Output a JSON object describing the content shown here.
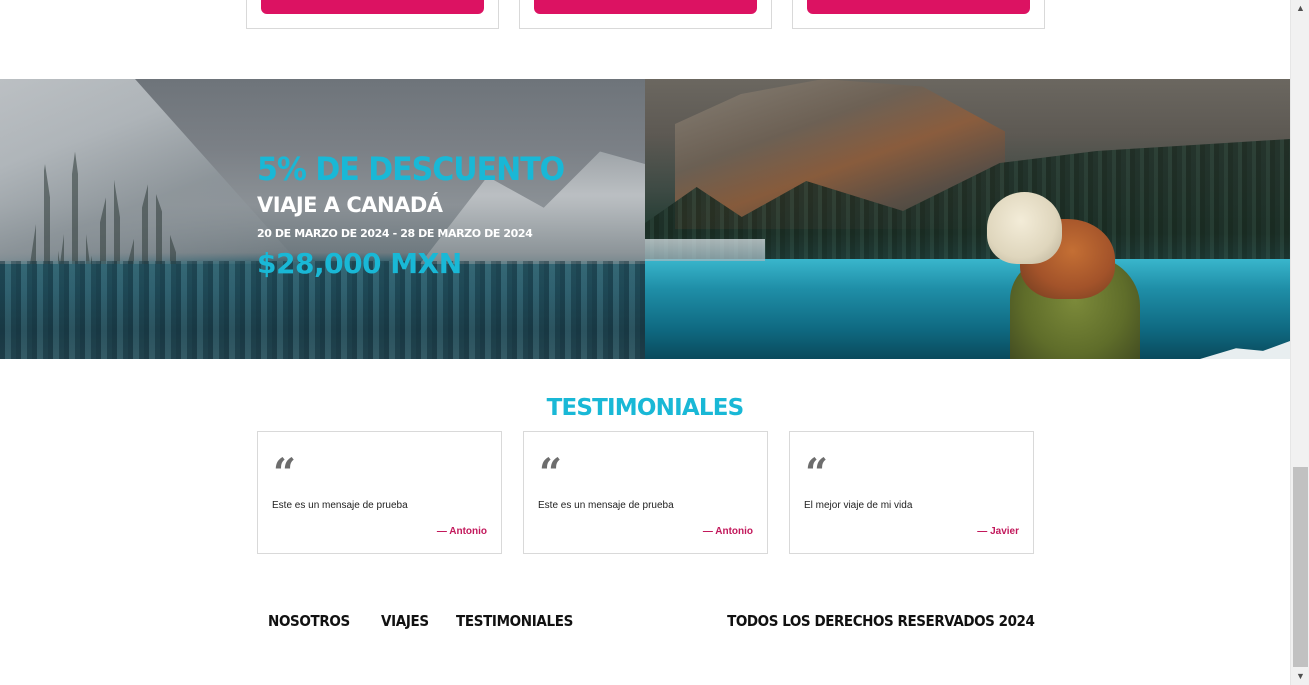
{
  "promo": {
    "discount": "5% DE DESCUENTO",
    "trip": "VIAJE A CANADÁ",
    "dates": "20 DE MARZO DE 2024 - 28 DE MARZO DE 2024",
    "price": "$28,000 MXN"
  },
  "testimonials": {
    "title": "TESTIMONIALES",
    "items": [
      {
        "message": "Este es un mensaje de prueba",
        "author": "— Antonio"
      },
      {
        "message": "Este es un mensaje de prueba",
        "author": "— Antonio"
      },
      {
        "message": "El mejor viaje de mi vida",
        "author": "— Javier"
      }
    ]
  },
  "footer": {
    "nav": [
      "NOSOTROS",
      "VIAJES",
      "TESTIMONIALES"
    ],
    "copyright": "TODOS LOS DERECHOS RESERVADOS 2024"
  },
  "icons": {
    "quote": "quote-icon",
    "scroll_up": "chevron-up-icon",
    "scroll_down": "chevron-down-icon"
  },
  "colors": {
    "accent_pink": "#dc1262",
    "accent_cyan": "#19b8d6",
    "author_pink": "#c2185b"
  }
}
